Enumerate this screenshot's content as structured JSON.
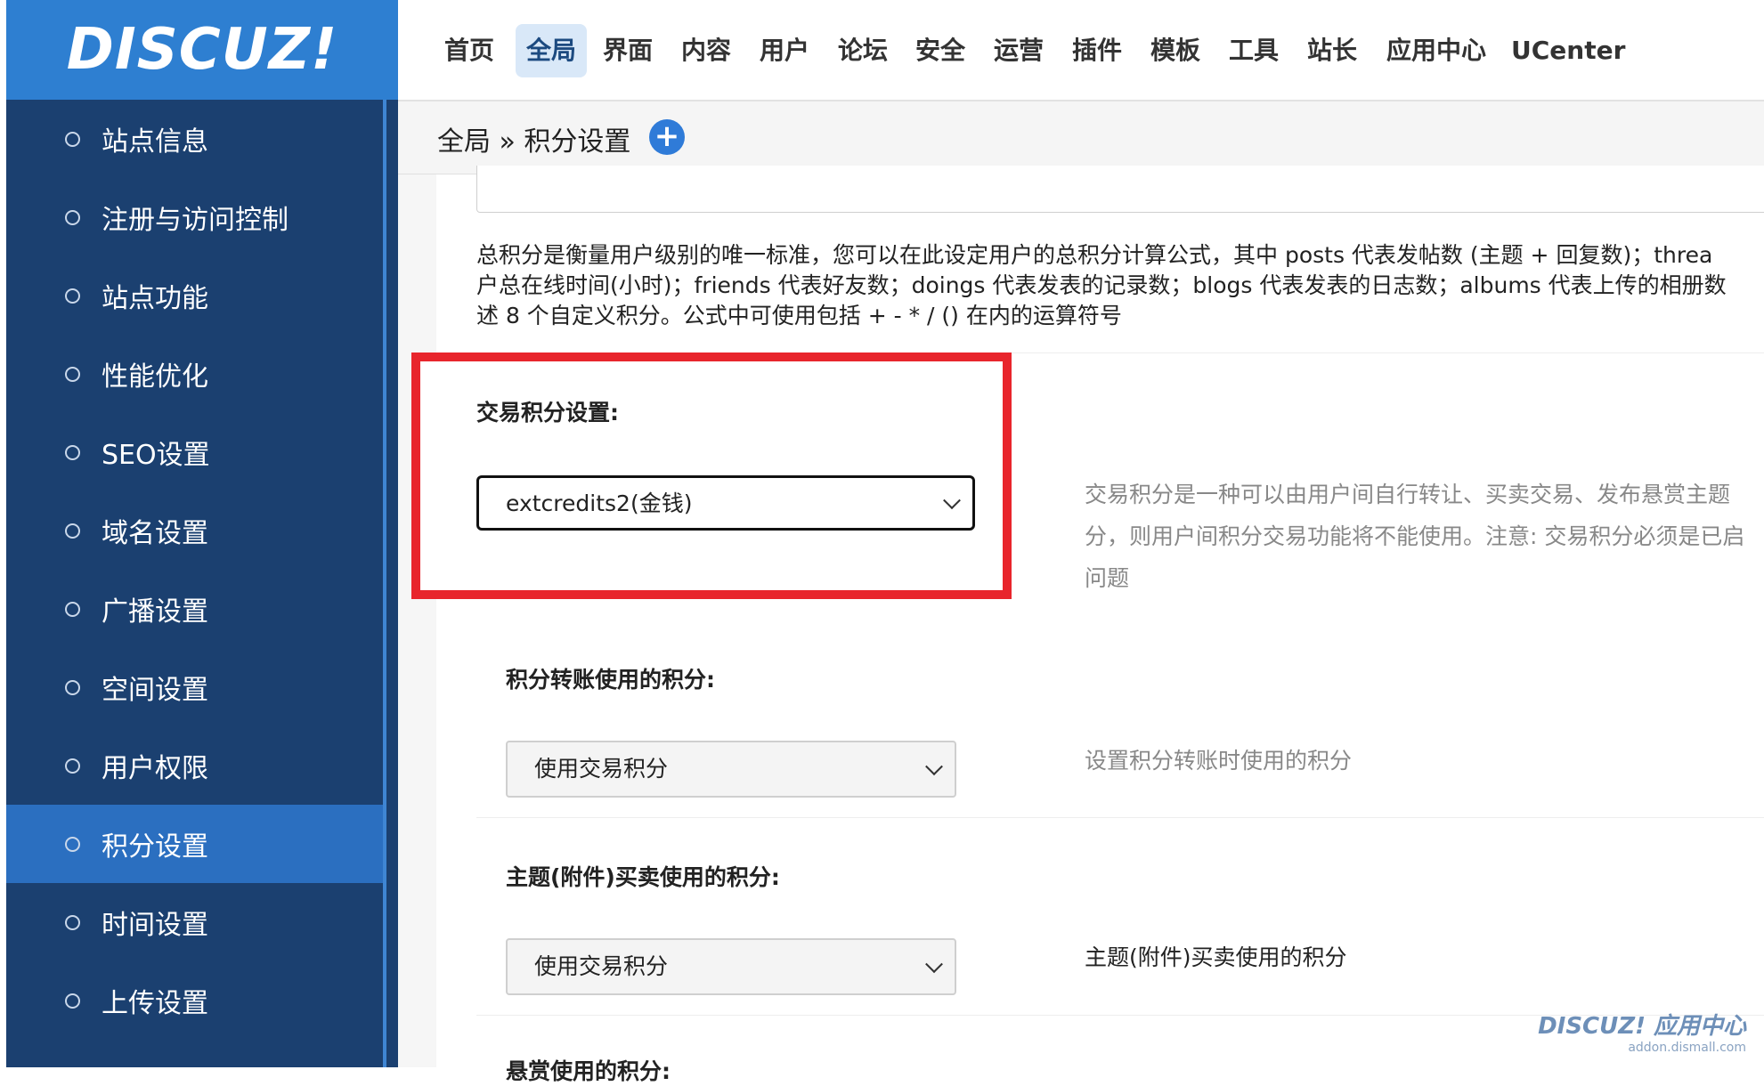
{
  "logo": {
    "text": "DISCUZ!"
  },
  "nav": {
    "items": [
      {
        "label": "首页",
        "active": false
      },
      {
        "label": "全局",
        "active": true
      },
      {
        "label": "界面",
        "active": false
      },
      {
        "label": "内容",
        "active": false
      },
      {
        "label": "用户",
        "active": false
      },
      {
        "label": "论坛",
        "active": false
      },
      {
        "label": "安全",
        "active": false
      },
      {
        "label": "运营",
        "active": false
      },
      {
        "label": "插件",
        "active": false
      },
      {
        "label": "模板",
        "active": false
      },
      {
        "label": "工具",
        "active": false
      },
      {
        "label": "站长",
        "active": false
      },
      {
        "label": "应用中心",
        "active": false
      },
      {
        "label": "UCenter",
        "active": false
      }
    ]
  },
  "breadcrumb": {
    "text": "全局 » 积分设置",
    "add_icon": "plus-circle-icon"
  },
  "sidebar": {
    "items": [
      {
        "label": "站点信息"
      },
      {
        "label": "注册与访问控制"
      },
      {
        "label": "站点功能"
      },
      {
        "label": "性能优化"
      },
      {
        "label": "SEO设置"
      },
      {
        "label": "域名设置"
      },
      {
        "label": "广播设置"
      },
      {
        "label": "空间设置"
      },
      {
        "label": "用户权限"
      },
      {
        "label": "积分设置",
        "active": true
      },
      {
        "label": "时间设置"
      },
      {
        "label": "上传设置"
      }
    ]
  },
  "main": {
    "formula_desc": [
      "总积分是衡量用户级别的唯一标准，您可以在此设定用户的总积分计算公式，其中 posts 代表发帖数 (主题 + 回复数)；threa",
      "户总在线时间(小时)；friends 代表好友数；doings 代表发表的记录数；blogs 代表发表的日志数；albums 代表上传的相册数",
      "述 8 个自定义积分。公式中可使用包括 + - * / () 在内的运算符号"
    ],
    "trade_credit": {
      "label": "交易积分设置:",
      "value": "extcredits2(金钱)",
      "desc": [
        "交易积分是一种可以由用户间自行转让、买卖交易、发布悬赏主题",
        "分，则用户间积分交易功能将不能使用。注意: 交易积分必须是已启",
        "问题"
      ]
    },
    "transfer_credit": {
      "label": "积分转账使用的积分:",
      "value": "使用交易积分",
      "desc": "设置积分转账时使用的积分"
    },
    "topic_credit": {
      "label": "主题(附件)买卖使用的积分:",
      "value": "使用交易积分",
      "desc": "主题(附件)买卖使用的积分"
    },
    "reward_credit": {
      "label": "悬赏使用的积分:"
    }
  },
  "watermark": {
    "main": "DISCUZ! 应用中心",
    "sub": "addon.dismall.com"
  },
  "colors": {
    "sidebar_bg": "#1b4070",
    "sidebar_active": "#2b6fc0",
    "logo_bg": "#2e7fd1",
    "highlight": "#e8252c",
    "nav_active_bg": "#d9e8f8"
  }
}
